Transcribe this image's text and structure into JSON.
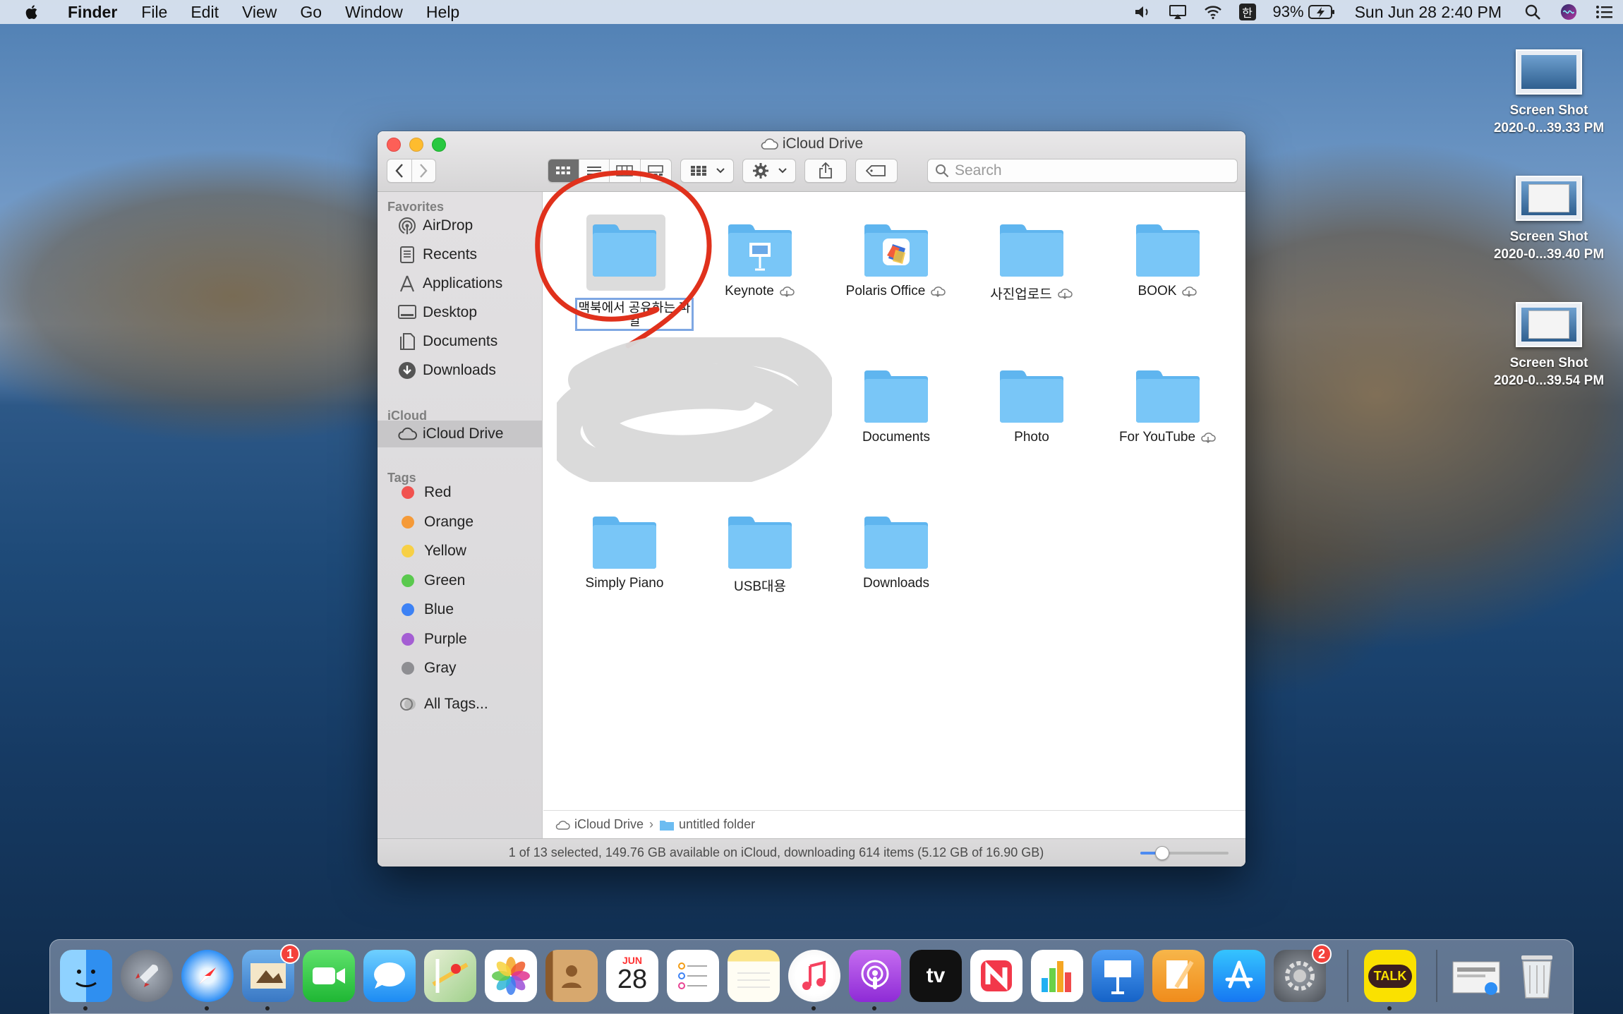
{
  "menubar": {
    "app": "Finder",
    "items": [
      "File",
      "Edit",
      "View",
      "Go",
      "Window",
      "Help"
    ],
    "input_method": "한",
    "battery": "93%",
    "clock": "Sun Jun 28  2:40 PM"
  },
  "desktop": {
    "items": [
      {
        "line1": "Screen Shot",
        "line2": "2020-0...39.33 PM"
      },
      {
        "line1": "Screen Shot",
        "line2": "2020-0...39.40 PM"
      },
      {
        "line1": "Screen Shot",
        "line2": "2020-0...39.54 PM"
      }
    ]
  },
  "window": {
    "title": "iCloud Drive",
    "search_placeholder": "Search"
  },
  "sidebar": {
    "favorites_heading": "Favorites",
    "favorites": [
      "AirDrop",
      "Recents",
      "Applications",
      "Desktop",
      "Documents",
      "Downloads"
    ],
    "icloud_heading": "iCloud",
    "icloud_items": [
      "iCloud Drive"
    ],
    "tags_heading": "Tags",
    "tags": [
      {
        "label": "Red",
        "color": "#f1524f"
      },
      {
        "label": "Orange",
        "color": "#f59a38"
      },
      {
        "label": "Yellow",
        "color": "#f7d046"
      },
      {
        "label": "Green",
        "color": "#5ac94e"
      },
      {
        "label": "Blue",
        "color": "#3d82f5"
      },
      {
        "label": "Purple",
        "color": "#a45ed3"
      },
      {
        "label": "Gray",
        "color": "#8e8e92"
      }
    ],
    "all_tags": "All Tags..."
  },
  "files": [
    {
      "name_line1": "맥북에서 공유하는 파",
      "name_line2": "일",
      "renaming": true
    },
    {
      "name": "Keynote",
      "cloud": true,
      "icon": "keynote-folder-icon"
    },
    {
      "name": "Polaris Office",
      "cloud": true,
      "icon": "polaris-folder-icon"
    },
    {
      "name": "사진업로드",
      "cloud": true,
      "icon": "folder-icon"
    },
    {
      "name": "BOOK",
      "cloud": true,
      "icon": "folder-icon"
    },
    {
      "name": "Documents",
      "cloud": false,
      "icon": "folder-icon"
    },
    {
      "name": "Photo",
      "cloud": false,
      "icon": "folder-icon"
    },
    {
      "name": "For YouTube",
      "cloud": true,
      "icon": "folder-icon"
    },
    {
      "name": "Simply Piano",
      "cloud": false,
      "icon": "folder-icon"
    },
    {
      "name": "USB대용",
      "cloud": false,
      "icon": "folder-icon"
    },
    {
      "name": "Downloads",
      "cloud": false,
      "icon": "folder-icon"
    }
  ],
  "pathbar": {
    "root": "iCloud Drive",
    "current": "untitled folder"
  },
  "status": {
    "text": "1 of 13 selected, 149.76 GB available on iCloud, downloading 614 items (5.12 GB of 16.90 GB)",
    "icon_size_level": 0.25
  },
  "dock": {
    "calendar_month": "JUN",
    "calendar_day": "28",
    "mail_badge": "1",
    "prefs_badge": "2",
    "kakao_label": "TALK",
    "tv_label": "tv"
  },
  "colors": {
    "accent": "#3d82f5",
    "annotation": "#e0311c",
    "folder": "#6cbcf1"
  }
}
